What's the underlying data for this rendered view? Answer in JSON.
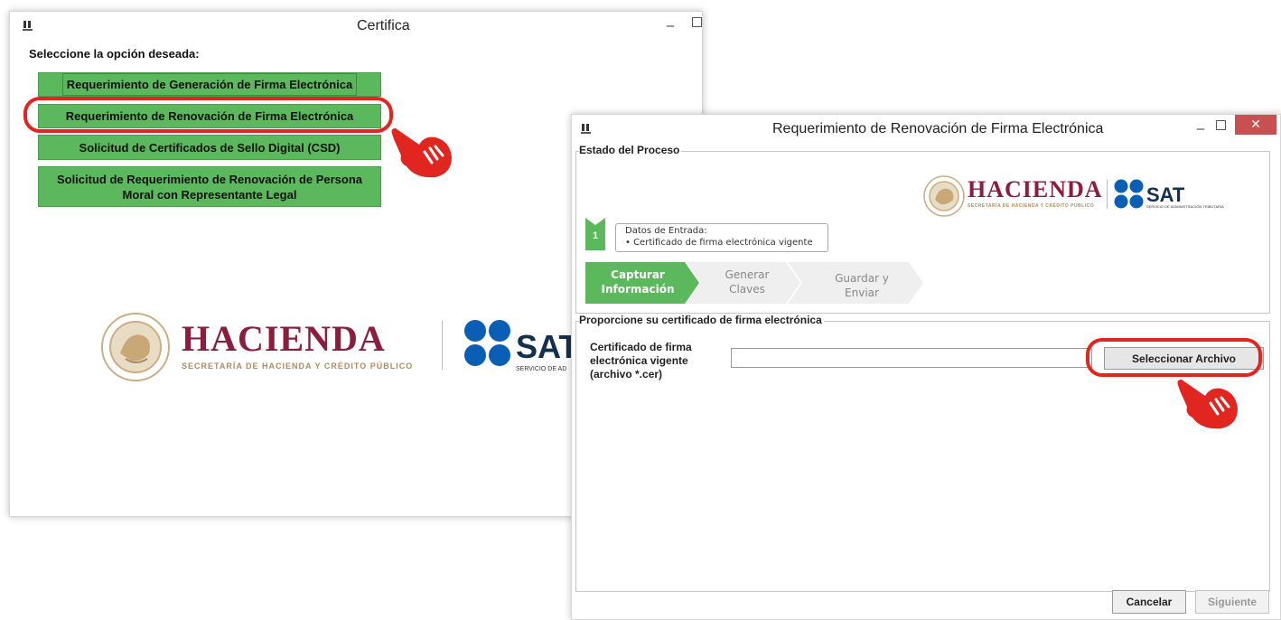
{
  "left_window": {
    "title": "Certifica",
    "prompt": "Seleccione la opción deseada:",
    "options": [
      "Requerimiento de Generación de Firma Electrónica",
      "Requerimiento de Renovación de Firma Electrónica",
      "Solicitud de Certificados de Sello Digital (CSD)",
      "Solicitud de Requerimiento de Renovación de Persona Moral con Representante Legal"
    ],
    "option4_line1": "Solicitud de Requerimiento de Renovación de Persona",
    "option4_line2": "Moral con Representante Legal",
    "logo_hacienda": "HACIENDA",
    "logo_hacienda_sub": "SECRETARÍA DE HACIENDA Y CRÉDITO PÚBLICO",
    "logo_sat": "SAT",
    "logo_sat_sub": "SERVICIO DE AD"
  },
  "right_window": {
    "title": "Requerimiento de Renovación de Firma Electrónica",
    "section_process": "Estado del Proceso",
    "logo_hacienda": "HACIENDA",
    "logo_hacienda_sub": "SECRETARÍA DE HACIENDA Y CRÉDITO PÚBLICO",
    "logo_sat": "SAT",
    "logo_sat_sub": "SERVICIO DE ADMINISTRACIÓN TRIBUTARIA",
    "step_number": "1",
    "input_data_title": "Datos de Entrada:",
    "input_data_item": "Certificado de firma electrónica vigente",
    "steps": [
      {
        "line1": "Capturar",
        "line2": "Información",
        "active": true
      },
      {
        "line1": "Generar",
        "line2": "Claves",
        "active": false
      },
      {
        "line1": "Guardar y",
        "line2": "Enviar",
        "active": false
      }
    ],
    "section_cert": "Proporcione su certificado de firma electrónica",
    "cert_label_lines": [
      "Certificado de firma",
      "electrónica vigente",
      "(archivo *.cer)"
    ],
    "cert_input_value": "",
    "select_file_label": "Seleccionar Archivo",
    "cancel_label": "Cancelar",
    "next_label": "Siguiente"
  },
  "colors": {
    "green": "#5cb85c",
    "highlight_red": "#e0261f",
    "close_red": "#c75050",
    "hacienda": "#8b1e3f",
    "sat_blue": "#0a5fb4"
  }
}
